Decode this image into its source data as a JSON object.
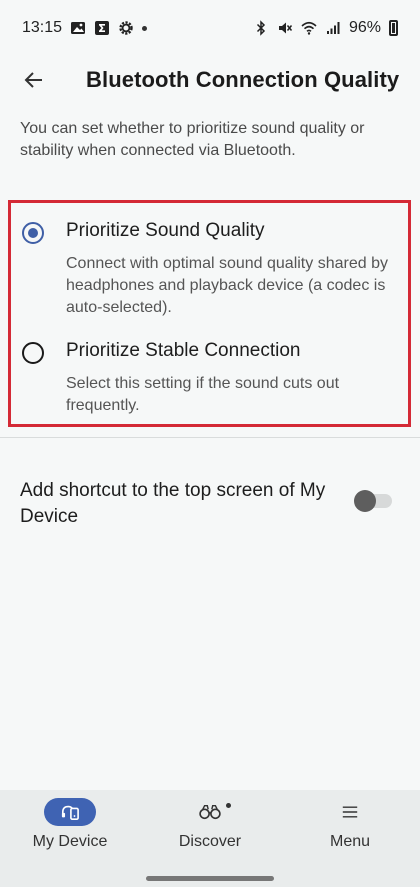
{
  "status_bar": {
    "time": "13:15",
    "battery": "96%"
  },
  "header": {
    "title": "Bluetooth Connection Quality"
  },
  "description": "You can set whether to prioritize sound quality or stability when connected via Bluetooth.",
  "options": [
    {
      "label": "Prioritize Sound Quality",
      "description": "Connect with optimal sound quality shared by headphones and playback device (a codec is auto-selected).",
      "selected": true
    },
    {
      "label": "Prioritize Stable Connection",
      "description": "Select this setting if the sound cuts out frequently.",
      "selected": false
    }
  ],
  "shortcut": {
    "label": "Add shortcut to the top screen of My Device",
    "enabled": false
  },
  "bottom_nav": {
    "items": [
      {
        "label": "My Device",
        "icon": "headphones-phone-icon",
        "active": true
      },
      {
        "label": "Discover",
        "icon": "binoculars-icon",
        "active": false
      },
      {
        "label": "Menu",
        "icon": "menu-icon",
        "active": false
      }
    ]
  },
  "colors": {
    "accent": "#3f5fa6",
    "highlight_border": "#d42a36",
    "background": "#f6f8f8"
  }
}
